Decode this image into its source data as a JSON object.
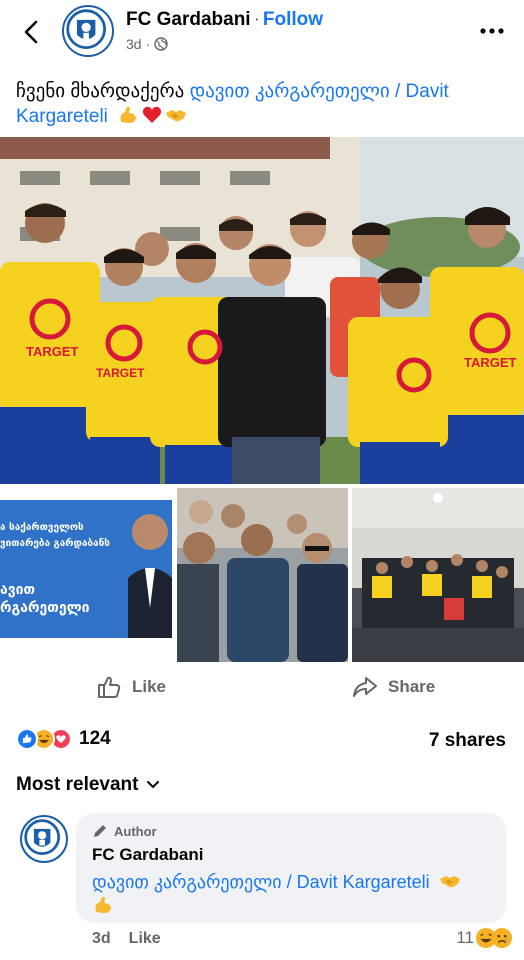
{
  "post": {
    "page_name": "FC Gardabani",
    "separator": "·",
    "follow_label": "Follow",
    "time": "3d",
    "meta_dot": "·",
    "caption_text": "ჩვენი მხარდაქერა ",
    "caption_mention": "დავით კარგარეთელი / Davit Kargareteli",
    "caption_emojis": [
      "flexed-biceps",
      "red-heart",
      "handshake"
    ]
  },
  "photos": {
    "banner_line1": "ა საქართველოს",
    "banner_line2": "ვითარება გარდაბანს",
    "banner_line3": "ავით",
    "banner_line4": "რგარეთელი",
    "jersey_text": "TARGET"
  },
  "actions": {
    "like_label": "Like",
    "share_label": "Share"
  },
  "stats": {
    "reaction_count": "124",
    "shares_label": "7 shares",
    "reaction_types": [
      "like",
      "haha",
      "love"
    ]
  },
  "comments": {
    "sort_label": "Most relevant",
    "items": [
      {
        "badge": "Author",
        "name": "FC Gardabani",
        "text": "დავით კარგარეთელი / Davit Kargareteli",
        "emojis": [
          "handshake",
          "flexed-biceps"
        ],
        "time": "3d",
        "like_label": "Like",
        "reaction_count": "11",
        "reaction_types": [
          "haha",
          "sad"
        ]
      }
    ]
  },
  "colors": {
    "brand_blue": "#1877f2",
    "text_secondary": "#65676b",
    "jersey_yellow": "#f4d21f",
    "jersey_blue": "#1a3f9c",
    "bubble_bg": "#f0f2f5"
  }
}
